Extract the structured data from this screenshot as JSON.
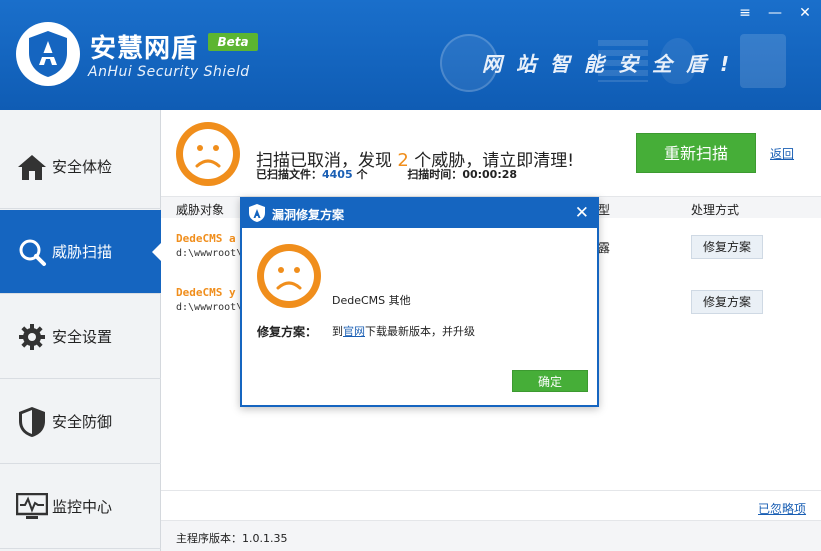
{
  "app": {
    "name": "安慧网盾",
    "badge": "Beta",
    "subtitle": "AnHui Security Shield",
    "slogan": "网站智能安全盾!",
    "window_controls": [
      "≡",
      "—",
      "✕"
    ]
  },
  "sidebar": {
    "items": [
      {
        "label": "安全体检",
        "icon": "home-icon"
      },
      {
        "label": "威胁扫描",
        "icon": "search-icon",
        "active": true
      },
      {
        "label": "安全设置",
        "icon": "gear-icon"
      },
      {
        "label": "安全防御",
        "icon": "shield-icon"
      },
      {
        "label": "监控中心",
        "icon": "monitor-icon"
      }
    ]
  },
  "scan": {
    "summary_pre": "扫描已取消，发现",
    "threat_count": "2",
    "summary_post": "个威胁，请立即清理!",
    "files_label": "已扫描文件：",
    "files_count": "4405",
    "files_unit": "个",
    "time_label": "扫描时间：",
    "time_value": "00:00:28",
    "rescan_label": "重新扫描",
    "back_label": "返回"
  },
  "table": {
    "columns": [
      "威胁对象",
      "型",
      "处理方式"
    ],
    "rows": [
      {
        "name": "DedeCMS a",
        "path": "d:\\wwwroot\\",
        "type": "露",
        "action": "修复方案"
      },
      {
        "name": "DedeCMS y",
        "path": "d:\\wwwroot\\",
        "type": "",
        "action": "修复方案"
      }
    ]
  },
  "footer": {
    "ignored_label": "已忽略项",
    "version_label": "主程序版本：",
    "version": "1.0.1.35"
  },
  "dialog": {
    "title": "漏洞修复方案",
    "close": "✕",
    "vuln_name": "DedeCMS 其他",
    "fix_label": "修复方案：",
    "fix_pre": "到",
    "fix_link": "官网",
    "fix_post": "下载最新版本，并升级",
    "ok_label": "确定"
  },
  "colors": {
    "brand_blue": "#1565c0",
    "accent_orange": "#f08e1c",
    "action_green": "#46ae38"
  }
}
